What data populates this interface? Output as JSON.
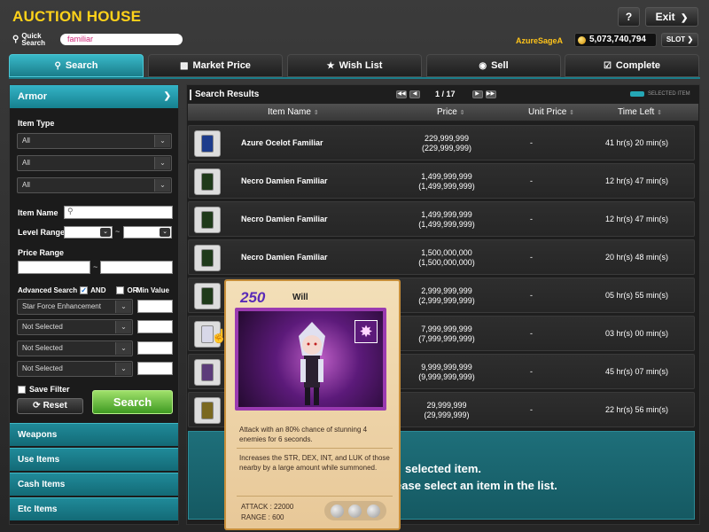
{
  "header": {
    "title": "AUCTION HOUSE",
    "quick_search_label_1": "Quick",
    "quick_search_label_2": "Search",
    "quick_search_value": "familiar",
    "help_label": "?",
    "exit_label": "Exit",
    "player_name": "AzureSageA",
    "meso": "5,073,740,794",
    "slot_label": "SLOT"
  },
  "tabs": [
    {
      "label": "Search",
      "icon": "search-icon",
      "active": true
    },
    {
      "label": "Market Price",
      "icon": "chart-icon",
      "active": false
    },
    {
      "label": "Wish List",
      "icon": "star-icon",
      "active": false
    },
    {
      "label": "Sell",
      "icon": "coin-icon",
      "active": false
    },
    {
      "label": "Complete",
      "icon": "checkbox-icon",
      "active": false
    }
  ],
  "sidebar": {
    "category": "Armor",
    "item_type_label": "Item Type",
    "item_type_selects": [
      "All",
      "All",
      "All"
    ],
    "item_name_label": "Item Name",
    "level_range_label": "Level Range",
    "level_separator": "~",
    "price_range_label": "Price Range",
    "price_separator": "~",
    "advanced_search_label": "Advanced Search",
    "and_label": "AND",
    "or_label": "OR",
    "min_value_label": "Min Value",
    "advanced_selects": [
      "Star Force Enhancement",
      "Not Selected",
      "Not Selected",
      "Not Selected"
    ],
    "save_filter_label": "Save Filter",
    "reset_label": "Reset",
    "search_label": "Search",
    "categories": [
      "Weapons",
      "Use Items",
      "Cash Items",
      "Etc Items"
    ]
  },
  "results": {
    "title": "Search Results",
    "page": "1 / 17",
    "legend": "SELECTED ITEM",
    "columns": {
      "item_name": "Item Name",
      "price": "Price",
      "unit_price": "Unit Price",
      "time_left": "Time Left"
    },
    "rows": [
      {
        "name": "Azure Ocelot Familiar",
        "price": "229,999,999",
        "price_sub": "(229,999,999)",
        "unit": "-",
        "time": "41 hr(s) 20 min(s)",
        "color": "blue"
      },
      {
        "name": "Necro Damien Familiar",
        "price": "1,499,999,999",
        "price_sub": "(1,499,999,999)",
        "unit": "-",
        "time": "12 hr(s) 47 min(s)",
        "color": "green"
      },
      {
        "name": "Necro Damien Familiar",
        "price": "1,499,999,999",
        "price_sub": "(1,499,999,999)",
        "unit": "-",
        "time": "12 hr(s) 47 min(s)",
        "color": "green"
      },
      {
        "name": "Necro Damien Familiar",
        "price": "1,500,000,000",
        "price_sub": "(1,500,000,000)",
        "unit": "-",
        "time": "20 hr(s) 48 min(s)",
        "color": "green"
      },
      {
        "name": "",
        "price": "2,999,999,999",
        "price_sub": "(2,999,999,999)",
        "unit": "-",
        "time": "05 hr(s) 55 min(s)",
        "color": "green"
      },
      {
        "name": "",
        "price": "7,999,999,999",
        "price_sub": "(7,999,999,999)",
        "unit": "-",
        "time": "03 hr(s) 00 min(s)",
        "color": "white"
      },
      {
        "name": "",
        "price": "9,999,999,999",
        "price_sub": "(9,999,999,999)",
        "unit": "-",
        "time": "45 hr(s) 07 min(s)",
        "color": "purple"
      },
      {
        "name": "",
        "price": "29,999,999",
        "price_sub": "(29,999,999)",
        "unit": "-",
        "time": "22 hr(s) 56 min(s)",
        "color": "gold"
      }
    ],
    "detail_line_1": "selected item.",
    "detail_line_2": "ease select an item in the list."
  },
  "tooltip": {
    "level": "250",
    "name": "Will",
    "desc_1": "Attack with an 80% chance of stunning 4 enemies for 6 seconds.",
    "desc_2": "Increases the STR, DEX, INT, and LUK of those nearby by a large amount while summoned.",
    "attack": "ATTACK : 22000",
    "range": "RANGE : 600"
  },
  "colors": {
    "accent": "#25a7b5",
    "title": "#ffd21a",
    "search_button": "#6cc23f"
  }
}
